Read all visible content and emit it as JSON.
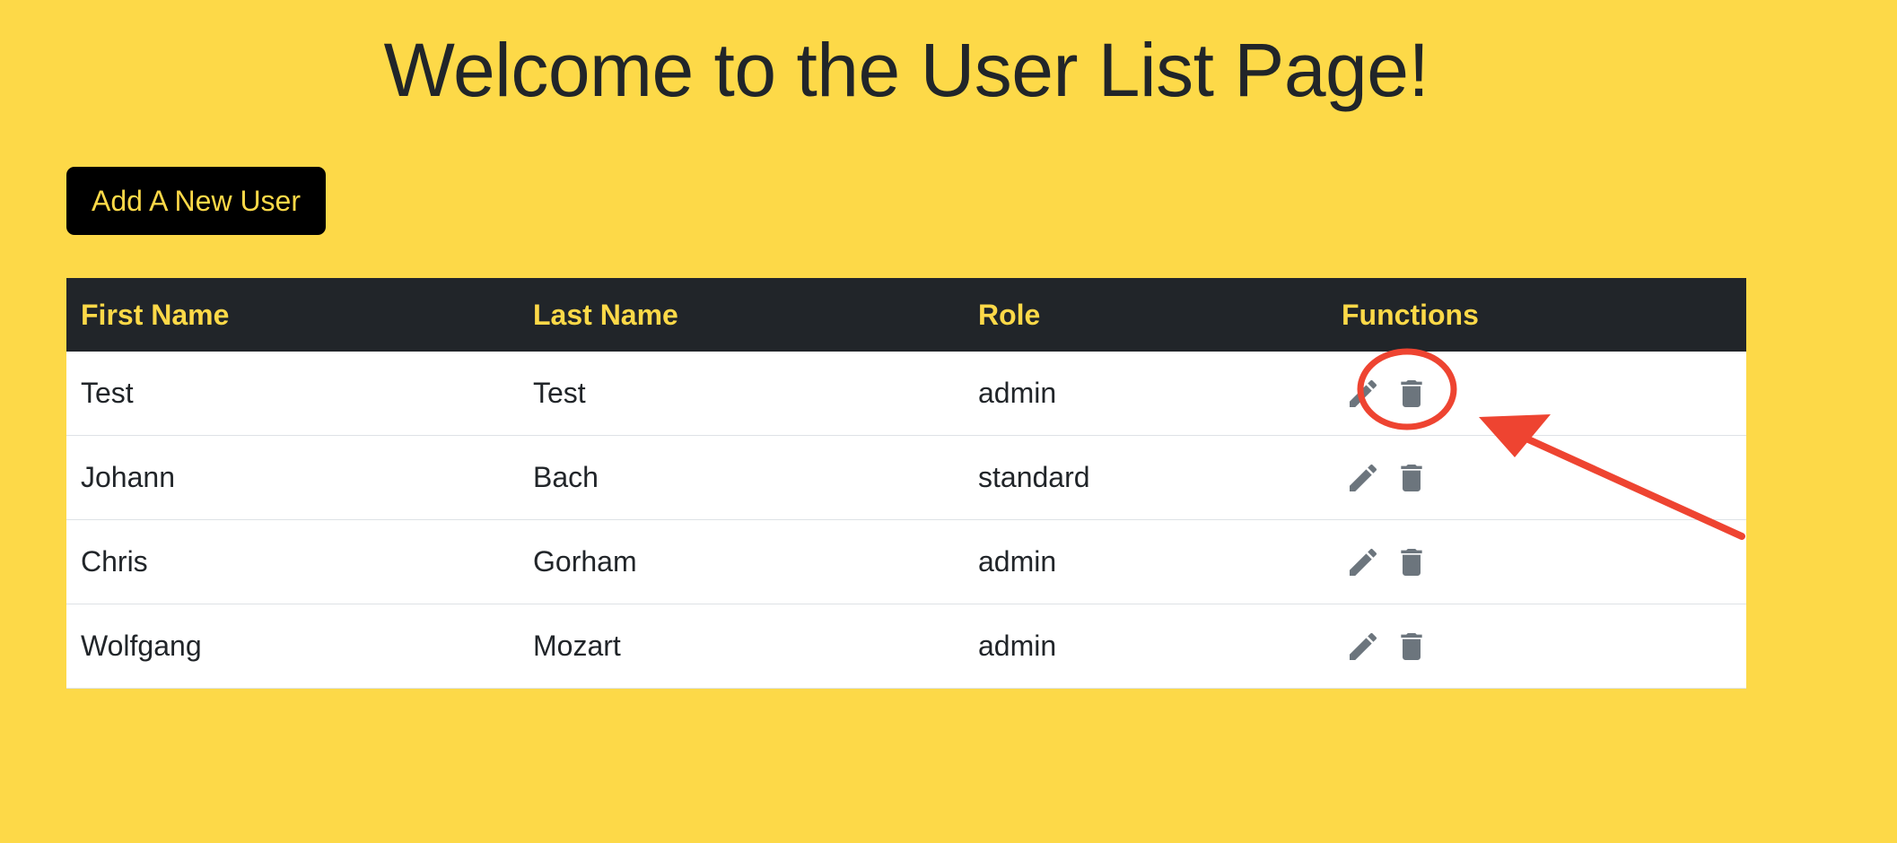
{
  "page": {
    "title": "Welcome to the User List Page!",
    "background_color": "#FDD948"
  },
  "toolbar": {
    "add_user_label": "Add A New User"
  },
  "table": {
    "headers": [
      "First Name",
      "Last Name",
      "Role",
      "Functions"
    ],
    "rows": [
      {
        "first": "Test",
        "last": "Test",
        "role": "admin"
      },
      {
        "first": "Johann",
        "last": "Bach",
        "role": "standard"
      },
      {
        "first": "Chris",
        "last": "Gorham",
        "role": "admin"
      },
      {
        "first": "Wolfgang",
        "last": "Mozart",
        "role": "admin"
      }
    ],
    "row_actions": [
      "pencil-icon",
      "trash-icon"
    ]
  },
  "annotation": {
    "color": "#EE4431",
    "shapes": [
      "circle",
      "arrow"
    ]
  }
}
